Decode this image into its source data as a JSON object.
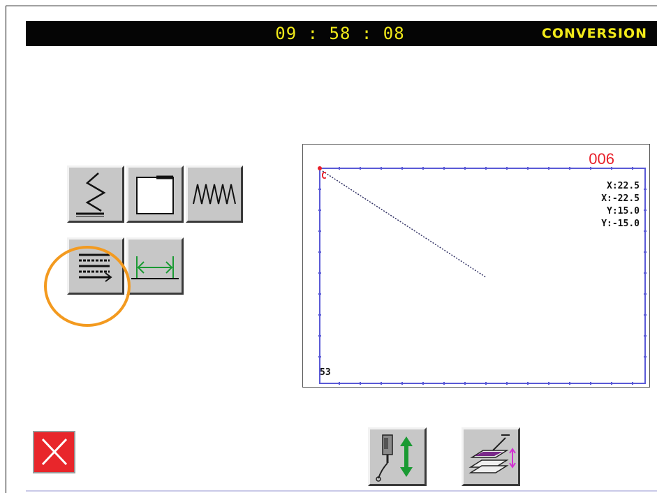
{
  "header": {
    "clock": "09 : 58 : 08",
    "mode_title": "CONVERSION"
  },
  "mode_buttons": [
    {
      "icon": "zigzag-icon"
    },
    {
      "icon": "rectangle-icon"
    },
    {
      "icon": "multi-zigzag-icon"
    },
    {
      "icon": "parallel-lines-icon"
    },
    {
      "icon": "width-arrows-icon"
    }
  ],
  "preview": {
    "pattern_number": "006",
    "coords": [
      "X:22.5",
      "X:-22.5",
      "Y:15.0",
      "Y:-15.0"
    ],
    "origin_marker": "C",
    "stitch_count": "53"
  },
  "bottom_buttons": [
    {
      "icon": "cancel-x-icon"
    },
    {
      "icon": "needle-up-down-icon"
    },
    {
      "icon": "presser-lift-icon"
    }
  ],
  "colors": {
    "header_bg": "#050505",
    "header_text": "#f2ea1a",
    "pattern_number": "#e8202a",
    "grid": "#5a5ad6",
    "highlight": "#f39a1f",
    "cancel": "#e8262b"
  }
}
